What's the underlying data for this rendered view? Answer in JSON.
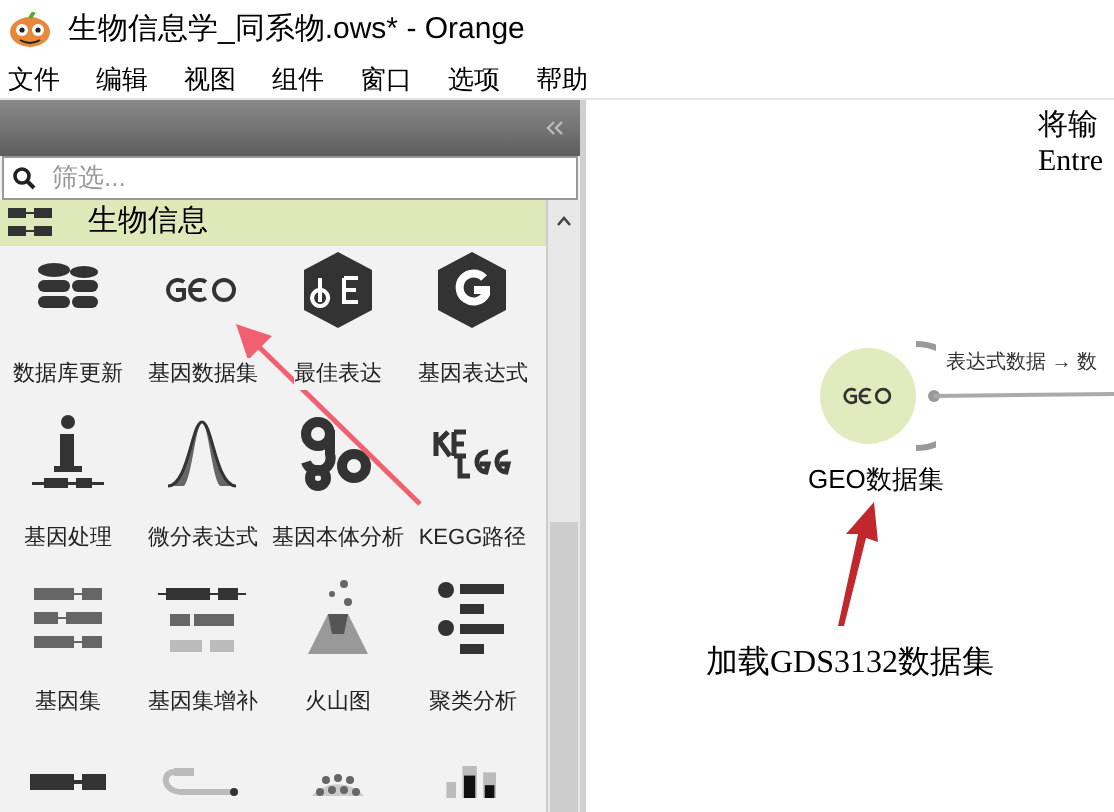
{
  "window": {
    "title": "生物信息学_同系物.ows* - Orange"
  },
  "menu": [
    "文件",
    "编辑",
    "视图",
    "组件",
    "窗口",
    "选项",
    "帮助"
  ],
  "dock": {
    "search": {
      "placeholder": "筛选..."
    },
    "category": "生物信息",
    "expanded": true,
    "widgets": [
      {
        "kind": "database",
        "label": "数据库更新"
      },
      {
        "kind": "geo",
        "label": "基因数据集"
      },
      {
        "kind": "de",
        "label": "最佳表达"
      },
      {
        "kind": "g",
        "label": "基因表达式"
      },
      {
        "kind": "info",
        "label": "基因处理"
      },
      {
        "kind": "bell",
        "label": "微分表达式"
      },
      {
        "kind": "go",
        "label": "基因本体分析"
      },
      {
        "kind": "kegg",
        "label": "KEGG路径"
      },
      {
        "kind": "sets",
        "label": "基因集"
      },
      {
        "kind": "enrich",
        "label": "基因集增补"
      },
      {
        "kind": "volcano",
        "label": "火山图"
      },
      {
        "kind": "cluster",
        "label": "聚类分析"
      },
      {
        "kind": "bar"
      },
      {
        "kind": "cable"
      },
      {
        "kind": "dots"
      },
      {
        "kind": "bars"
      }
    ]
  },
  "canvas": {
    "note": [
      "将输",
      "Entre"
    ],
    "node": {
      "label": "GEO数据集",
      "link": "表达式数据 → 数"
    },
    "callout": "加载GDS3132数据集"
  }
}
